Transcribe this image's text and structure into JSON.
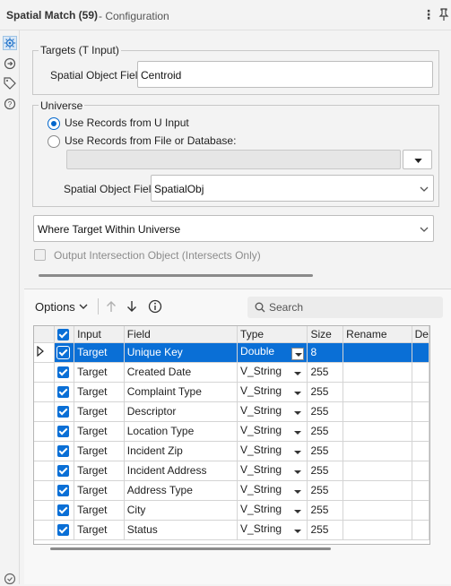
{
  "window": {
    "tool_title": "Spatial Match (59)",
    "config_title": "- Configuration"
  },
  "targets": {
    "legend": "Targets (T Input)",
    "field_label": "Spatial Object Field:",
    "field_value": "Centroid"
  },
  "universe": {
    "legend": "Universe",
    "radio_u_input": "Use Records from U Input",
    "radio_file_db": "Use Records from File or Database:",
    "file_path_value": "",
    "field_label": "Spatial Object Field:",
    "field_value": "SpatialObj",
    "selected_source": "u_input"
  },
  "match_mode": {
    "value": "Where Target Within Universe"
  },
  "output_intersection": {
    "label": "Output Intersection Object (Intersects Only)",
    "checked": false
  },
  "toolbar": {
    "options_label": "Options",
    "search_placeholder": "Search"
  },
  "table": {
    "columns": [
      "",
      "Input",
      "Field",
      "Type",
      "Size",
      "Rename",
      "De"
    ],
    "rows": [
      {
        "input": "Target",
        "field": "Unique Key",
        "type": "Double",
        "size": "8",
        "rename": "",
        "selected": true
      },
      {
        "input": "Target",
        "field": "Created Date",
        "type": "V_String",
        "size": "255",
        "rename": ""
      },
      {
        "input": "Target",
        "field": "Complaint Type",
        "type": "V_String",
        "size": "255",
        "rename": ""
      },
      {
        "input": "Target",
        "field": "Descriptor",
        "type": "V_String",
        "size": "255",
        "rename": ""
      },
      {
        "input": "Target",
        "field": "Location Type",
        "type": "V_String",
        "size": "255",
        "rename": ""
      },
      {
        "input": "Target",
        "field": "Incident Zip",
        "type": "V_String",
        "size": "255",
        "rename": ""
      },
      {
        "input": "Target",
        "field": "Incident Address",
        "type": "V_String",
        "size": "255",
        "rename": ""
      },
      {
        "input": "Target",
        "field": "Address Type",
        "type": "V_String",
        "size": "255",
        "rename": ""
      },
      {
        "input": "Target",
        "field": "City",
        "type": "V_String",
        "size": "255",
        "rename": ""
      },
      {
        "input": "Target",
        "field": "Status",
        "type": "V_String",
        "size": "255",
        "rename": ""
      }
    ]
  },
  "colors": {
    "accent": "#0a6fd6",
    "selection": "#0a6fd6",
    "pane_bg": "#f3f3f3"
  },
  "icons": {
    "rail": [
      "gear-icon",
      "connection-icon",
      "tag-icon",
      "help-icon"
    ],
    "toolbar": [
      "chevron-down-icon",
      "arrow-up-icon",
      "arrow-down-icon",
      "info-icon",
      "search-icon"
    ]
  }
}
